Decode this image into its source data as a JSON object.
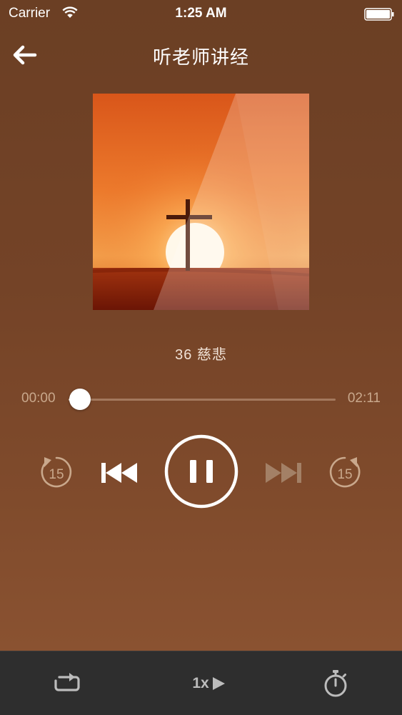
{
  "status_bar": {
    "carrier": "Carrier",
    "time": "1:25 AM"
  },
  "nav": {
    "title": "听老师讲经"
  },
  "player": {
    "track_title": "36 慈悲",
    "current_time": "00:00",
    "total_time": "02:11",
    "progress_fraction": 0.03,
    "state": "playing",
    "skip_seconds": "15"
  },
  "toolbar": {
    "speed_label": "1x"
  },
  "icons": {
    "back": "back-arrow-icon",
    "rewind": "rewind-15-icon",
    "previous": "previous-track-icon",
    "pause": "pause-icon",
    "next": "next-track-icon",
    "forward": "forward-15-icon",
    "repeat": "repeat-icon",
    "play": "play-triangle-icon",
    "timer": "stopwatch-icon"
  },
  "colors": {
    "accent": "#ffffff",
    "background": "#744327",
    "toolbar": "#2e2e2e",
    "muted_text": "#c9a88c"
  }
}
